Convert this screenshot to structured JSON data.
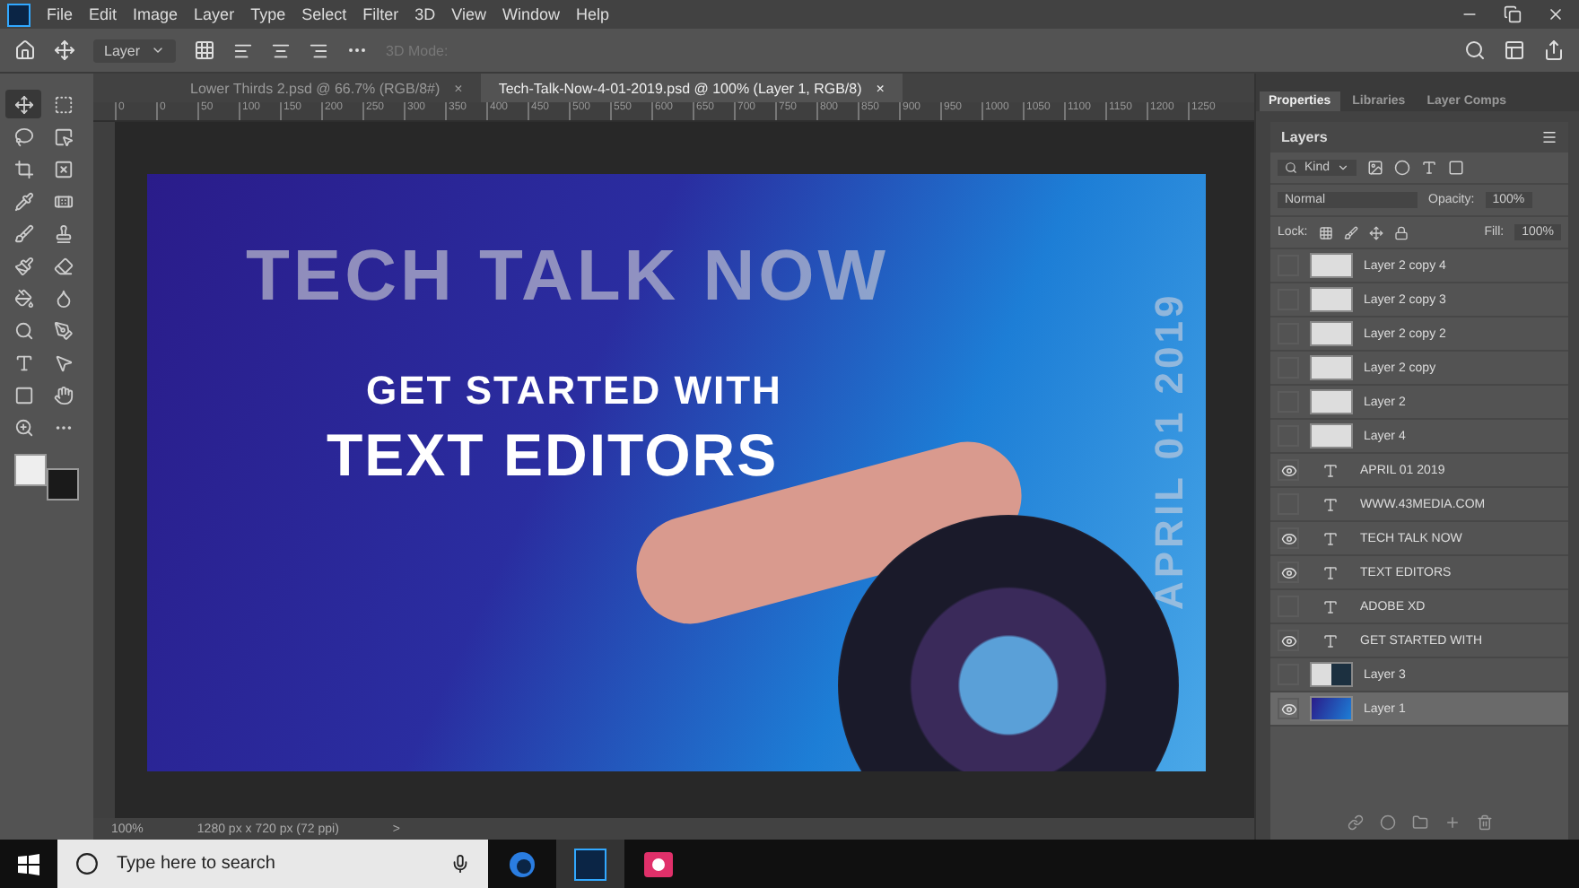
{
  "menu": [
    "File",
    "Edit",
    "Image",
    "Layer",
    "Type",
    "Select",
    "Filter",
    "3D",
    "View",
    "Window",
    "Help"
  ],
  "options_bar": {
    "layer_select": "Layer",
    "mode_label": "3D Mode:"
  },
  "doc_tabs": [
    {
      "label": "Lower Thirds 2.psd @ 66.7% (RGB/8#)",
      "close": "×",
      "selected": false
    },
    {
      "label": "Tech-Talk-Now-4-01-2019.psd @ 100% (Layer 1, RGB/8)",
      "close": "×",
      "selected": true
    }
  ],
  "ruler": [
    "0",
    "0",
    "50",
    "100",
    "150",
    "200",
    "250",
    "300",
    "350",
    "400",
    "450",
    "500",
    "550",
    "600",
    "650",
    "700",
    "750",
    "800",
    "850",
    "900",
    "950",
    "1000",
    "1050",
    "1100",
    "1150",
    "1200",
    "1250"
  ],
  "tools": [
    {
      "selected": true
    },
    {
      "selected": false
    },
    {
      "selected": false
    },
    {
      "selected": false
    },
    {
      "selected": false
    },
    {
      "selected": false
    },
    {
      "selected": false
    },
    {
      "selected": false
    },
    {
      "selected": false
    },
    {
      "selected": false
    },
    {
      "selected": false
    },
    {
      "selected": false
    },
    {
      "selected": false
    },
    {
      "selected": false
    },
    {
      "selected": false
    },
    {
      "selected": false
    },
    {
      "selected": false
    },
    {
      "selected": false
    },
    {
      "selected": false
    },
    {
      "selected": false
    },
    {
      "selected": false
    },
    {
      "selected": false
    }
  ],
  "artboard": {
    "title": "TECH TALK NOW",
    "subtitle": "GET STARTED WITH",
    "headline": "TEXT EDITORS",
    "date": "APRIL 01 2019"
  },
  "status_bar": {
    "zoom": "100%",
    "size": "1280 px x 720 px (72 ppi)",
    "arrow": ">"
  },
  "panel_tabs": [
    {
      "label": "Properties",
      "selected": true
    },
    {
      "label": "Libraries",
      "selected": false
    },
    {
      "label": "Layer Comps",
      "selected": false
    }
  ],
  "layers_panel": {
    "title": "Layers",
    "filter": "Kind",
    "blend": "Normal",
    "opacity_label": "Opacity:",
    "opacity": "100%",
    "lock_label": "Lock:",
    "fill_label": "Fill:",
    "fill": "100%",
    "layers": [
      {
        "name": "Layer 2 copy 4",
        "kind": "blank",
        "visible": false,
        "selected": false
      },
      {
        "name": "Layer 2 copy 3",
        "kind": "blank",
        "visible": false,
        "selected": false
      },
      {
        "name": "Layer 2 copy 2",
        "kind": "blank",
        "visible": false,
        "selected": false
      },
      {
        "name": "Layer 2 copy",
        "kind": "blank",
        "visible": false,
        "selected": false
      },
      {
        "name": "Layer 2",
        "kind": "blank",
        "visible": false,
        "selected": false
      },
      {
        "name": "Layer 4",
        "kind": "blank",
        "visible": false,
        "selected": false
      },
      {
        "name": "APRIL 01 2019",
        "kind": "text",
        "visible": true,
        "selected": false
      },
      {
        "name": "WWW.43MEDIA.COM",
        "kind": "text",
        "visible": false,
        "selected": false
      },
      {
        "name": "TECH TALK NOW",
        "kind": "text",
        "visible": true,
        "selected": false
      },
      {
        "name": "TEXT EDITORS",
        "kind": "text",
        "visible": true,
        "selected": false
      },
      {
        "name": "ADOBE XD",
        "kind": "text",
        "visible": false,
        "selected": false
      },
      {
        "name": "GET STARTED WITH",
        "kind": "text",
        "visible": true,
        "selected": false
      },
      {
        "name": "Layer 3",
        "kind": "split",
        "visible": false,
        "selected": false
      },
      {
        "name": "Layer 1",
        "kind": "photo",
        "visible": true,
        "selected": true
      }
    ]
  },
  "taskbar": {
    "search_placeholder": "Type here to search"
  }
}
